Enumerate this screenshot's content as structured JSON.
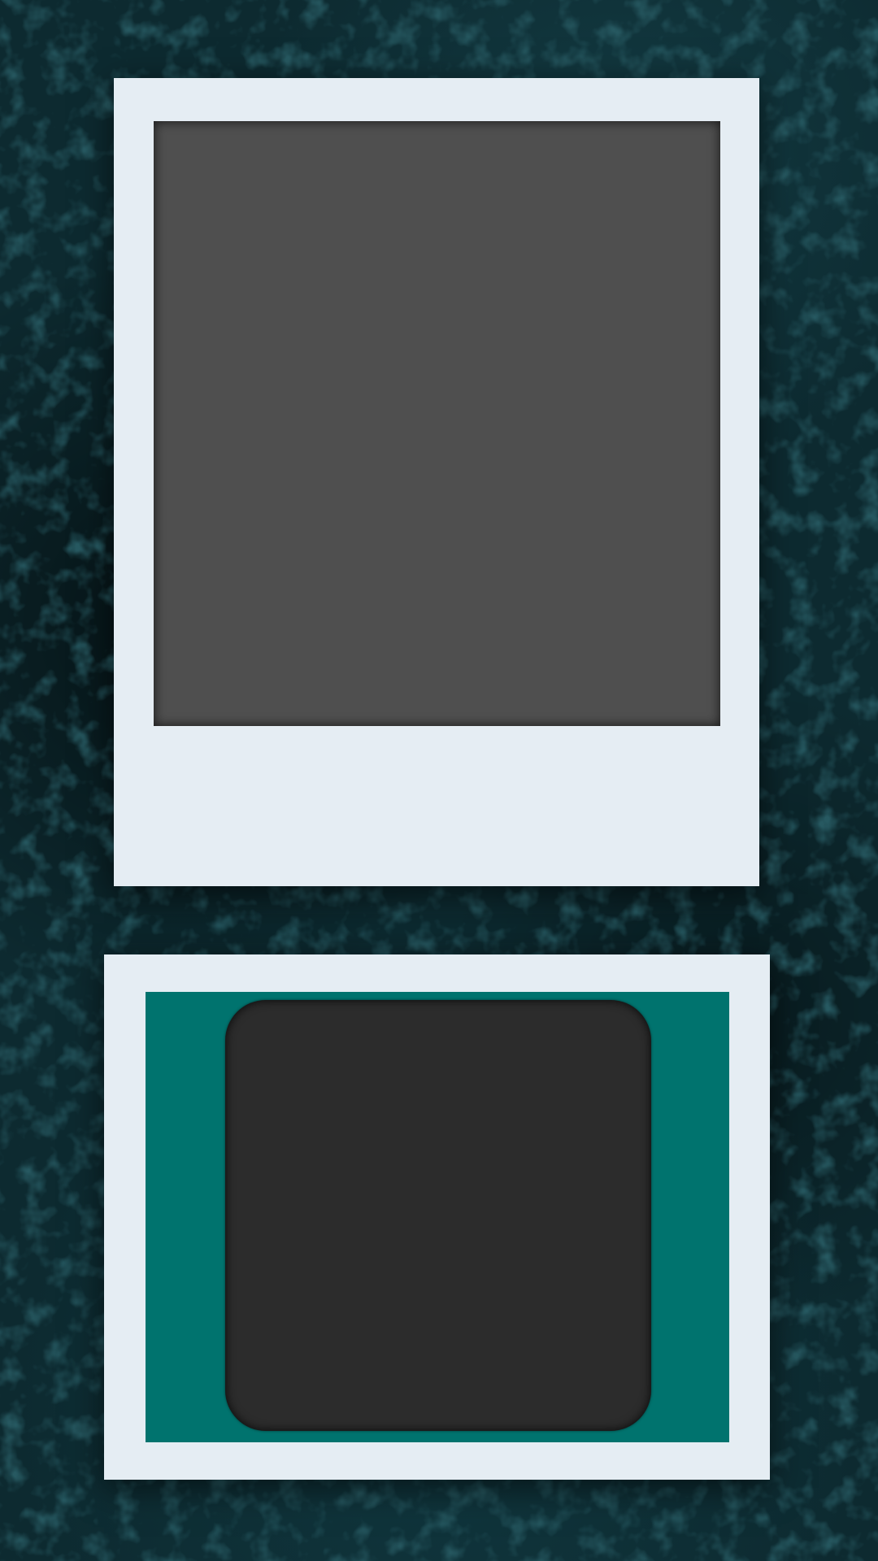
{
  "background": {
    "color": "#0d2a30",
    "texture": "camouflage-noise"
  },
  "top_frame": {
    "frame_color": "#e5edf3",
    "photo_color": "#4f4f4f",
    "caption": ""
  },
  "bottom_frame": {
    "frame_color": "#e5edf3",
    "mat_color": "#00736e",
    "screen_color": "#2c2c2c"
  }
}
